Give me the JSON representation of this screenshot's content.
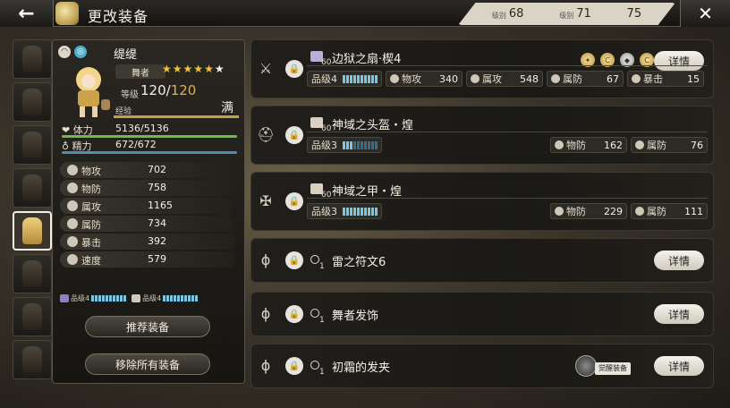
{
  "header": {
    "title": "更改装备",
    "back_icon": "←",
    "close_icon": "✕",
    "levels": [
      {
        "label": "级别",
        "value": "68"
      },
      {
        "label": "级别",
        "value": "71"
      },
      {
        "label": "",
        "value": "75"
      }
    ]
  },
  "character": {
    "name": "缇缇",
    "job": "舞者",
    "stars": 6,
    "level_label": "等级",
    "level_current": "120",
    "level_max": "120",
    "exp_label": "经验",
    "exp_status": "满",
    "hp_label": "体力",
    "hp_value": "5136/5136",
    "mp_label": "精力",
    "mp_value": "672/672",
    "stats": [
      {
        "label": "物攻",
        "value": "702"
      },
      {
        "label": "物防",
        "value": "758"
      },
      {
        "label": "属攻",
        "value": "1165"
      },
      {
        "label": "属防",
        "value": "734"
      },
      {
        "label": "暴击",
        "value": "392"
      },
      {
        "label": "速度",
        "value": "579"
      }
    ],
    "ranks": [
      {
        "label": "品级4",
        "filled": 10,
        "total": 10
      },
      {
        "label": "品级4",
        "filled": 10,
        "total": 10
      }
    ],
    "buttons": {
      "recommend": "推荐装备",
      "remove_all": "移除所有装备"
    }
  },
  "slots": [
    {
      "type": "weapon",
      "level": "60",
      "name": "边狱之扇·楔4",
      "rank": "品级4",
      "rank_fill": 10,
      "stats": [
        {
          "label": "物攻",
          "value": "340"
        },
        {
          "label": "属攻",
          "value": "548"
        },
        {
          "label": "属防",
          "value": "67"
        },
        {
          "label": "暴击",
          "value": "15"
        }
      ],
      "detail": "详情"
    },
    {
      "type": "head",
      "level": "60",
      "name": "神域之头盔・煌",
      "rank": "品级3",
      "rank_fill": 3,
      "stats": [
        {
          "label": "物防",
          "value": "162"
        },
        {
          "label": "属防",
          "value": "76"
        }
      ]
    },
    {
      "type": "body",
      "level": "60",
      "name": "神域之甲・煌",
      "rank": "品级3",
      "rank_fill": 10,
      "stats": [
        {
          "label": "物防",
          "value": "229"
        },
        {
          "label": "属防",
          "value": "111"
        }
      ]
    },
    {
      "type": "accessory",
      "level": "1",
      "name": "雷之符文6",
      "detail": "详情"
    },
    {
      "type": "accessory",
      "level": "1",
      "name": "舞者发饰",
      "detail": "详情"
    },
    {
      "type": "accessory",
      "level": "1",
      "name": "初霜的发夹",
      "detail": "详情",
      "awaken_label": "觉醒装备"
    }
  ]
}
